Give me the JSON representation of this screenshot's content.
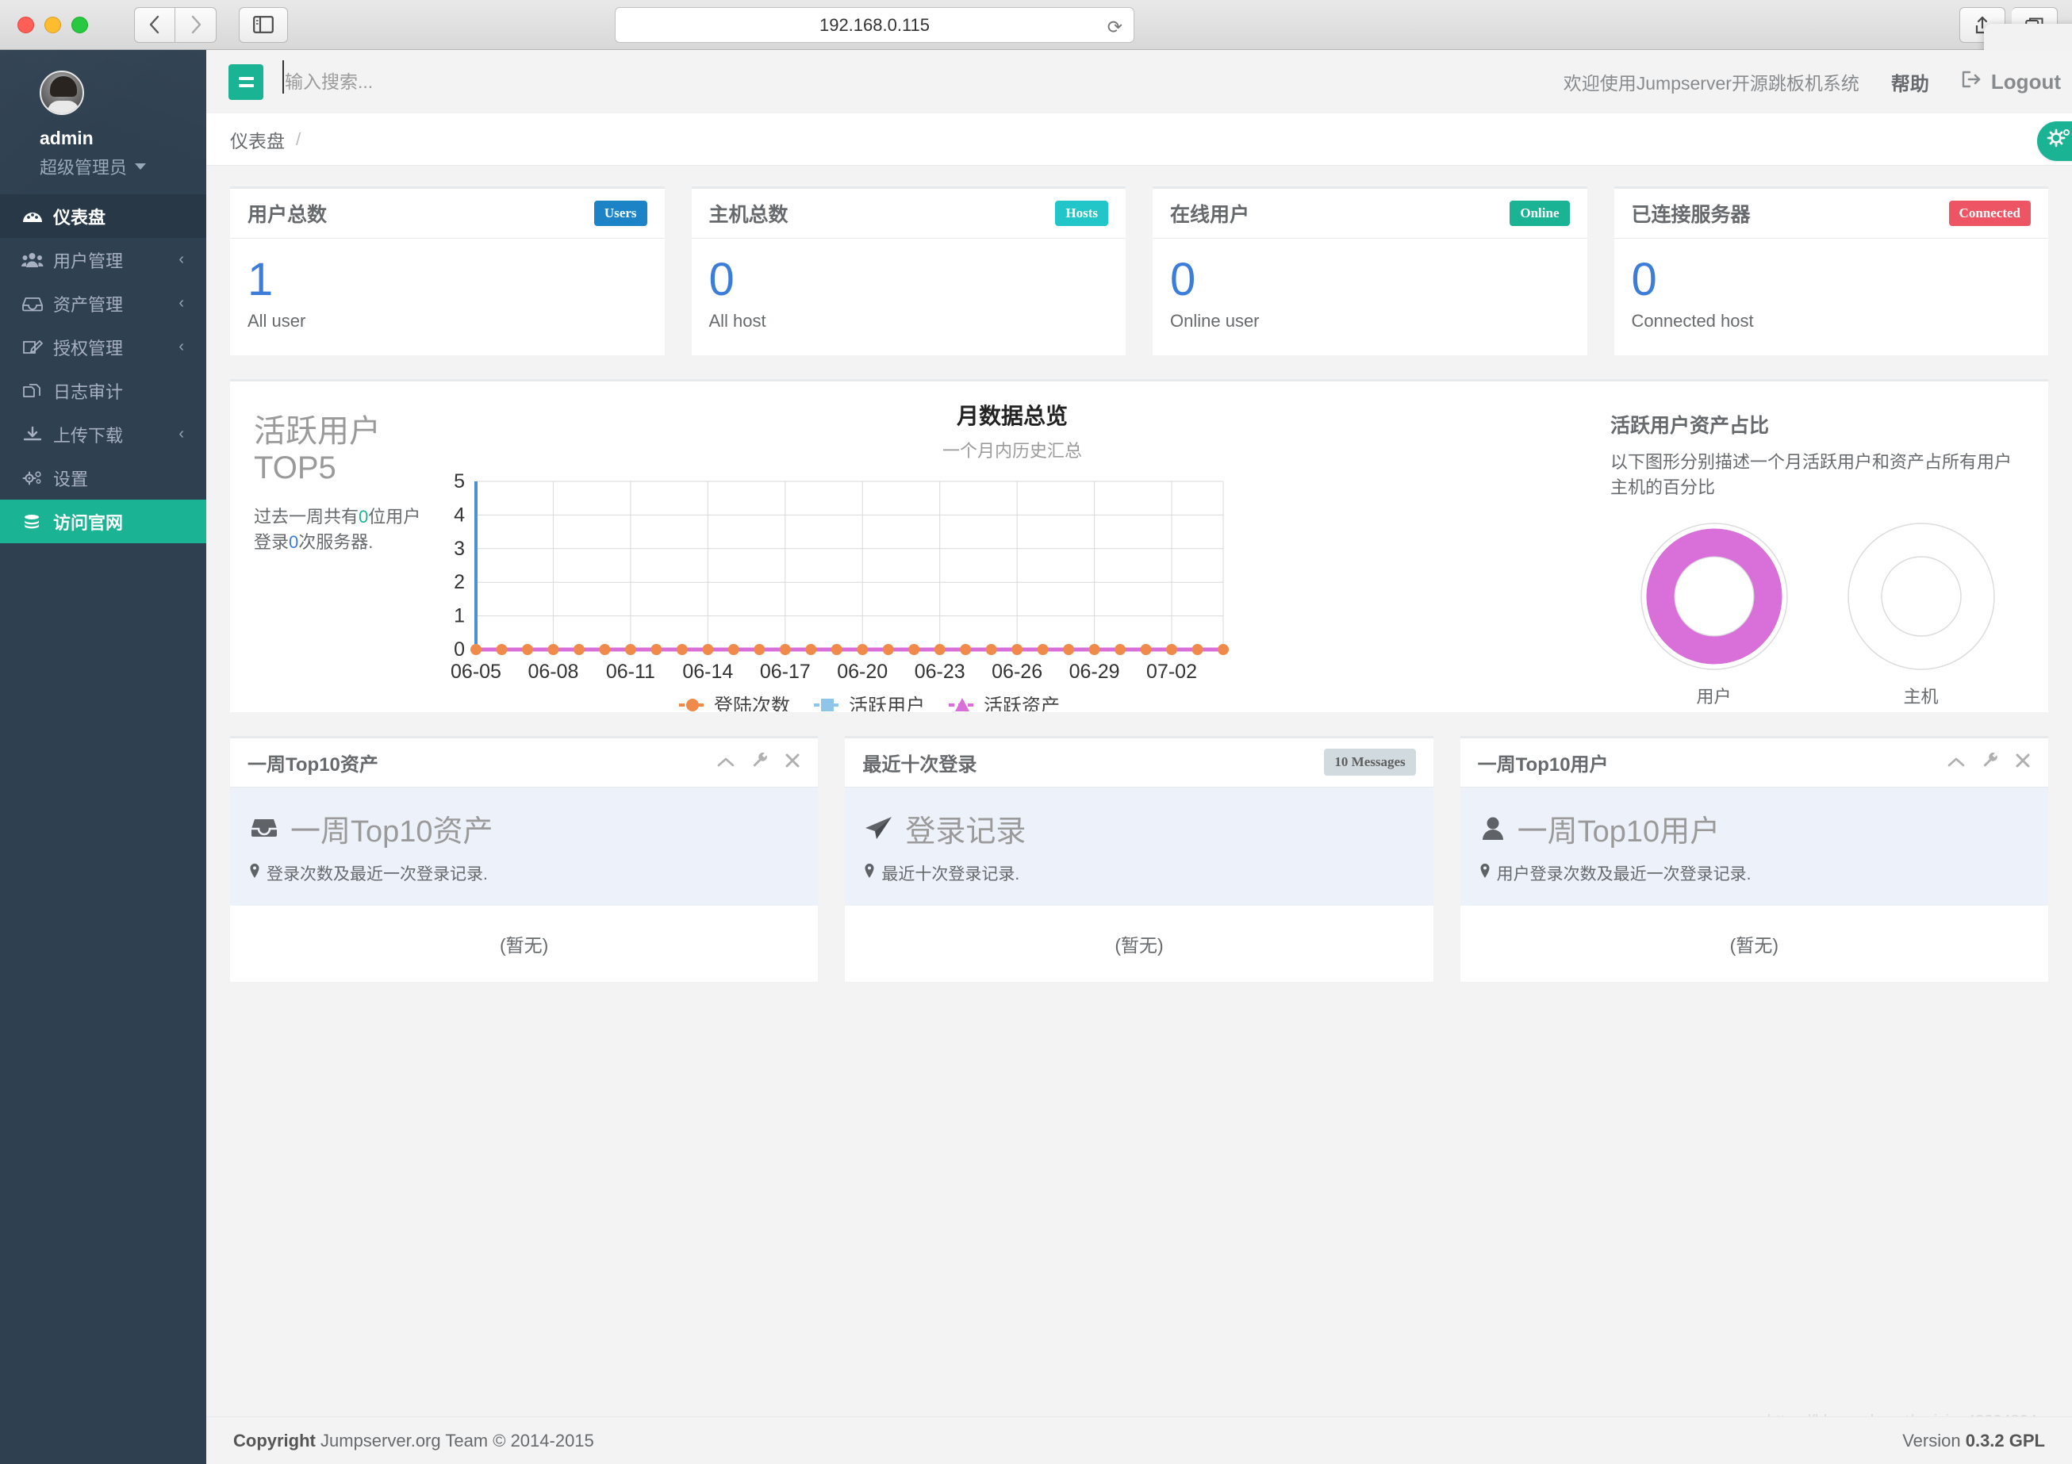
{
  "browser": {
    "url": "192.168.0.115",
    "back_icon": "chevron-left-icon",
    "forward_icon": "chevron-right-icon",
    "sidebar_icon": "sidebar-toggle-icon",
    "reload_icon": "reload-icon",
    "share_icon": "share-icon",
    "tabs_icon": "show-tabs-icon"
  },
  "sidebar": {
    "user": {
      "name": "admin",
      "role": "超级管理员"
    },
    "items": [
      {
        "label": "仪表盘",
        "icon": "dashboard-icon",
        "state": "active",
        "chevron": ""
      },
      {
        "label": "用户管理",
        "icon": "users-icon",
        "state": "normal",
        "chevron": "‹"
      },
      {
        "label": "资产管理",
        "icon": "inbox-icon",
        "state": "normal",
        "chevron": "‹"
      },
      {
        "label": "授权管理",
        "icon": "edit-icon",
        "state": "normal",
        "chevron": "‹"
      },
      {
        "label": "日志审计",
        "icon": "files-icon",
        "state": "normal",
        "chevron": ""
      },
      {
        "label": "上传下载",
        "icon": "download-icon",
        "state": "normal",
        "chevron": "‹"
      },
      {
        "label": "设置",
        "icon": "gears-icon",
        "state": "normal",
        "chevron": ""
      },
      {
        "label": "访问官网",
        "icon": "database-icon",
        "state": "highlight",
        "chevron": ""
      }
    ]
  },
  "topbar": {
    "search_placeholder": "输入搜索...",
    "welcome": "欢迎使用Jumpserver开源跳板机系统",
    "help": "帮助",
    "logout": "Logout"
  },
  "breadcrumb": {
    "current": "仪表盘",
    "separator": "/"
  },
  "stats": [
    {
      "title": "用户总数",
      "badge": "Users",
      "badge_color": "#1c84c6",
      "value": "1",
      "label": "All user"
    },
    {
      "title": "主机总数",
      "badge": "Hosts",
      "badge_color": "#23c6c8",
      "value": "0",
      "label": "All host"
    },
    {
      "title": "在线用户",
      "badge": "Online",
      "badge_color": "#1ab394",
      "value": "0",
      "label": "Online user"
    },
    {
      "title": "已连接服务器",
      "badge": "Connected",
      "badge_color": "#ed5565",
      "value": "0",
      "label": "Connected host"
    }
  ],
  "active_users": {
    "heading_line1": "活跃用户",
    "heading_line2": "TOP5",
    "desc_prefix": "过去一周共有",
    "desc_users": "0",
    "desc_mid": "位用户登录",
    "desc_logins": "0",
    "desc_suffix": "次服务器."
  },
  "ratio": {
    "title": "活跃用户资产占比",
    "desc": "以下图形分别描述一个月活跃用户和资产占所有用户主机的百分比",
    "donuts": [
      {
        "label": "用户",
        "percent": 100,
        "color": "#d96fd9"
      },
      {
        "label": "主机",
        "percent": 0,
        "color": "#d96fd9"
      }
    ]
  },
  "panels": [
    {
      "title": "一周Top10资产",
      "tools": [
        "chevron-up-icon",
        "wrench-icon",
        "close-icon"
      ],
      "badge": "",
      "hero_title": "一周Top10资产",
      "hero_icon": "inbox-icon",
      "hero_sub": "登录次数及最近一次登录记录.",
      "body": "(暂无)"
    },
    {
      "title": "最近十次登录",
      "tools": [],
      "badge": "10 Messages",
      "hero_title": "登录记录",
      "hero_icon": "paper-plane-icon",
      "hero_sub": "最近十次登录记录.",
      "body": "(暂无)"
    },
    {
      "title": "一周Top10用户",
      "tools": [
        "chevron-up-icon",
        "wrench-icon",
        "close-icon"
      ],
      "badge": "",
      "hero_title": "一周Top10用户",
      "hero_icon": "user-icon",
      "hero_sub": "用户登录次数及最近一次登录记录.",
      "body": "(暂无)"
    }
  ],
  "footer": {
    "copyright_strong": "Copyright",
    "copyright_rest": " Jumpserver.org Team © 2014-2015",
    "version_label": "Version ",
    "version_value": "0.3.2 GPL",
    "watermark": "https://blog.csdn.net/weixin_43304804"
  },
  "chart_data": {
    "type": "line",
    "title": "月数据总览",
    "subtitle": "一个月内历史汇总",
    "xlabel": "",
    "ylabel": "",
    "ylim": [
      0,
      5
    ],
    "yticks": [
      0,
      1,
      2,
      3,
      4,
      5
    ],
    "grid": true,
    "legend_position": "bottom",
    "x_tick_labels": [
      "06-05",
      "06-08",
      "06-11",
      "06-14",
      "06-17",
      "06-20",
      "06-23",
      "06-26",
      "06-29",
      "07-02"
    ],
    "x": [
      "06-05",
      "06-06",
      "06-07",
      "06-08",
      "06-09",
      "06-10",
      "06-11",
      "06-12",
      "06-13",
      "06-14",
      "06-15",
      "06-16",
      "06-17",
      "06-18",
      "06-19",
      "06-20",
      "06-21",
      "06-22",
      "06-23",
      "06-24",
      "06-25",
      "06-26",
      "06-27",
      "06-28",
      "06-29",
      "06-30",
      "07-01",
      "07-02",
      "07-03",
      "07-04"
    ],
    "series": [
      {
        "name": "登陆次数",
        "color": "#f08a4b",
        "marker": "circle",
        "values": [
          0,
          0,
          0,
          0,
          0,
          0,
          0,
          0,
          0,
          0,
          0,
          0,
          0,
          0,
          0,
          0,
          0,
          0,
          0,
          0,
          0,
          0,
          0,
          0,
          0,
          0,
          0,
          0,
          0,
          0
        ]
      },
      {
        "name": "活跃用户",
        "color": "#8ec5e8",
        "marker": "square",
        "values": [
          0,
          0,
          0,
          0,
          0,
          0,
          0,
          0,
          0,
          0,
          0,
          0,
          0,
          0,
          0,
          0,
          0,
          0,
          0,
          0,
          0,
          0,
          0,
          0,
          0,
          0,
          0,
          0,
          0,
          0
        ]
      },
      {
        "name": "活跃资产",
        "color": "#d96fd9",
        "marker": "triangle",
        "values": [
          0,
          0,
          0,
          0,
          0,
          0,
          0,
          0,
          0,
          0,
          0,
          0,
          0,
          0,
          0,
          0,
          0,
          0,
          0,
          0,
          0,
          0,
          0,
          0,
          0,
          0,
          0,
          0,
          0,
          0
        ]
      }
    ]
  }
}
